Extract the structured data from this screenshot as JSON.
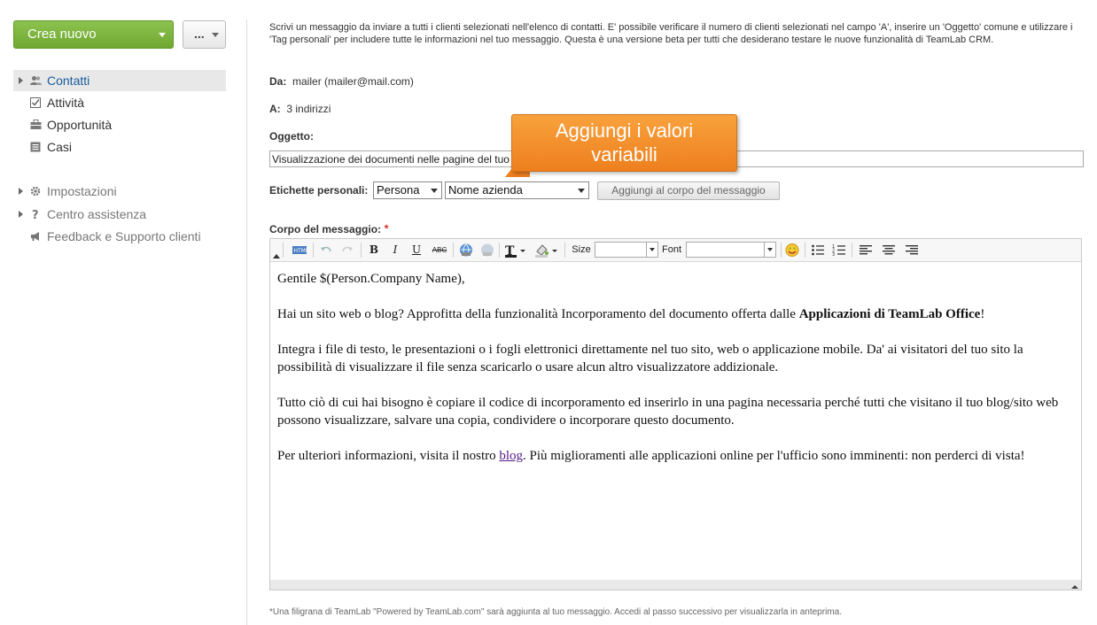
{
  "sidebar": {
    "new_button": "Crea nuovo",
    "more_button": "...",
    "nav": [
      {
        "label": "Contatti",
        "icon": "contacts-icon"
      },
      {
        "label": "Attività",
        "icon": "tasks-icon"
      },
      {
        "label": "Opportunità",
        "icon": "opportunities-icon"
      },
      {
        "label": "Casi",
        "icon": "cases-icon"
      }
    ],
    "secondary": [
      {
        "label": "Impostazioni",
        "icon": "gear-icon"
      },
      {
        "label": "Centro assistenza",
        "icon": "help-icon"
      },
      {
        "label": "Feedback e Supporto clienti",
        "icon": "megaphone-icon"
      }
    ]
  },
  "main": {
    "intro": "Scrivi un messaggio da inviare a tutti i clienti selezionati nell'elenco di contatti. E' possibile verificare il numero di clienti selezionati nel campo 'A', inserire un 'Oggetto' comune e utilizzare i 'Tag personali' per includere tutte le informazioni nel tuo messaggio. Questa è una versione beta per tutti che desiderano testare le nuove funzionalità di TeamLab CRM.",
    "from_label": "Da:",
    "from_value": "mailer (mailer@mail.com)",
    "to_label": "A:",
    "to_value": "3 indirizzi",
    "subject_label": "Oggetto:",
    "subject_value": "Visualizzazione dei documenti nelle pagine del tuo blog/sito web",
    "tags_label": "Etichette personali:",
    "tag_type": "Persona",
    "tag_field": "Nome azienda",
    "add_to_body_button": "Aggiungi al corpo del messaggio",
    "body_label": "Corpo del messaggio:",
    "required_mark": "*",
    "footer_note": "*Una filigrana di TeamLab \"Powered by TeamLab.com\" sarà aggiunta al tuo messaggio. Accedi al passo successivo per visualizzarla in anteprima."
  },
  "toolbar": {
    "bold": "B",
    "italic": "I",
    "underline": "U",
    "strike": "ABC",
    "size_label": "Size",
    "font_label": "Font"
  },
  "body": {
    "greeting": "Gentile $(Person.Company Name),",
    "p1_text": "Hai un sito web o blog? Approfitta della funzionalità Incorporamento del documento offerta dalle ",
    "p1_bold": "Applicazioni di TeamLab Office",
    "p1_end": "!",
    "p2": "Integra i file di testo, le presentazioni o i fogli elettronici direttamente nel tuo sito, web o applicazione mobile. Da' ai visitatori del tuo sito la possibilità di visualizzare il file senza scaricarlo o usare alcun altro visualizzatore addizionale.",
    "p3": "Tutto ciò di cui hai bisogno è copiare il codice di incorporamento ed inserirlo in una pagina necessaria perché tutti che visitano il tuo blog/sito web possono visualizzare, salvare una copia, condividere o incorporare questo documento.",
    "p4_start": "Per ulteriori informazioni, visita il nostro ",
    "p4_link": "blog",
    "p4_end": ". Più miglioramenti alle applicazioni online per l'ufficio sono imminenti: non perderci di vista!"
  },
  "callout": {
    "line1": "Aggiungi i valori",
    "line2": "variabili"
  }
}
